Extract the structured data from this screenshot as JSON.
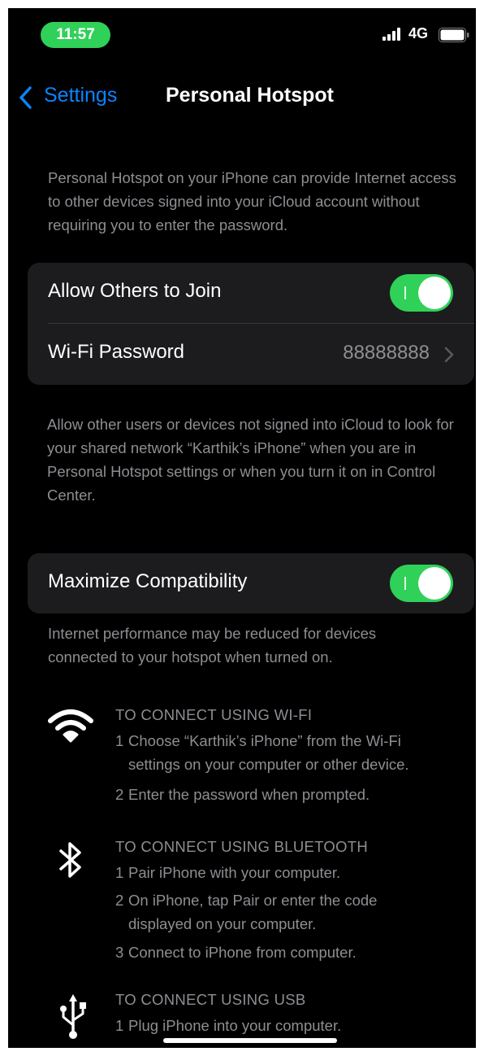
{
  "status_bar": {
    "time": "11:57",
    "network": "4G",
    "signal_icon": "cellular-signal-icon",
    "battery_icon": "battery-icon",
    "time_pill_color": "#30d158"
  },
  "nav": {
    "back_label": "Settings",
    "title": "Personal Hotspot",
    "accent_color": "#0a84ff"
  },
  "intro_text": "Personal Hotspot on your iPhone can provide Internet access to other devices signed into your iCloud account without requiring you to enter the password.",
  "allow_others": {
    "label": "Allow Others to Join",
    "enabled": true
  },
  "wifi_password": {
    "label": "Wi-Fi Password",
    "value": "88888888"
  },
  "allow_others_footer": "Allow other users or devices not signed into iCloud to look for your shared network “Karthik’s iPhone” when you are in Personal Hotspot settings or when you turn it on in Control Center.",
  "maximize_compat": {
    "label": "Maximize Compatibility",
    "enabled": true
  },
  "maximize_footer": "Internet performance may be reduced for devices connected to your hotspot when turned on.",
  "toggle_color": "#30d158",
  "instructions": {
    "wifi": {
      "icon": "wifi-icon",
      "title": "TO CONNECT USING WI-FI",
      "steps": [
        {
          "num": "1",
          "line1": "Choose “Karthik’s iPhone” from the Wi-Fi",
          "line2": "settings on your computer or other device."
        },
        {
          "num": "2",
          "line1": "Enter the password when prompted."
        }
      ]
    },
    "bluetooth": {
      "icon": "bluetooth-icon",
      "title": "TO CONNECT USING BLUETOOTH",
      "steps": [
        {
          "num": "1",
          "line1": "Pair iPhone with your computer."
        },
        {
          "num": "2",
          "line1": "On iPhone, tap Pair or enter the code",
          "line2": "displayed on your computer."
        },
        {
          "num": "3",
          "line1": "Connect to iPhone from computer."
        }
      ]
    },
    "usb": {
      "icon": "usb-icon",
      "title": "TO CONNECT USING USB",
      "steps": [
        {
          "num": "1",
          "line1": "Plug iPhone into your computer."
        }
      ]
    }
  }
}
